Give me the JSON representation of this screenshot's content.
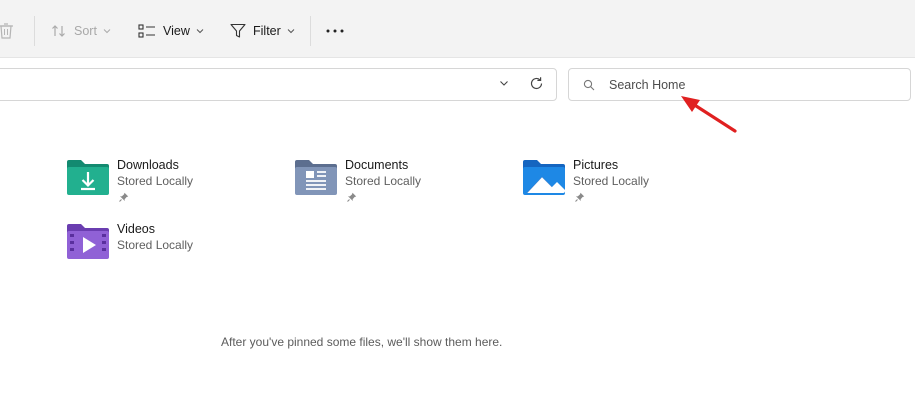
{
  "toolbar": {
    "sort_label": "Sort",
    "view_label": "View",
    "filter_label": "Filter"
  },
  "search": {
    "placeholder": "Search Home"
  },
  "folders": [
    {
      "name": "Downloads",
      "status": "Stored Locally",
      "pinned": true,
      "color": "#1fa58a"
    },
    {
      "name": "Documents",
      "status": "Stored Locally",
      "pinned": true,
      "color": "#7d8fb0"
    },
    {
      "name": "Pictures",
      "status": "Stored Locally",
      "pinned": true,
      "color": "#1e88e5"
    },
    {
      "name": "Videos",
      "status": "Stored Locally",
      "pinned": false,
      "color": "#8e5bd1"
    }
  ],
  "empty_message": "After you've pinned some files, we'll show them here.",
  "annotation": {
    "color": "#e02020"
  }
}
